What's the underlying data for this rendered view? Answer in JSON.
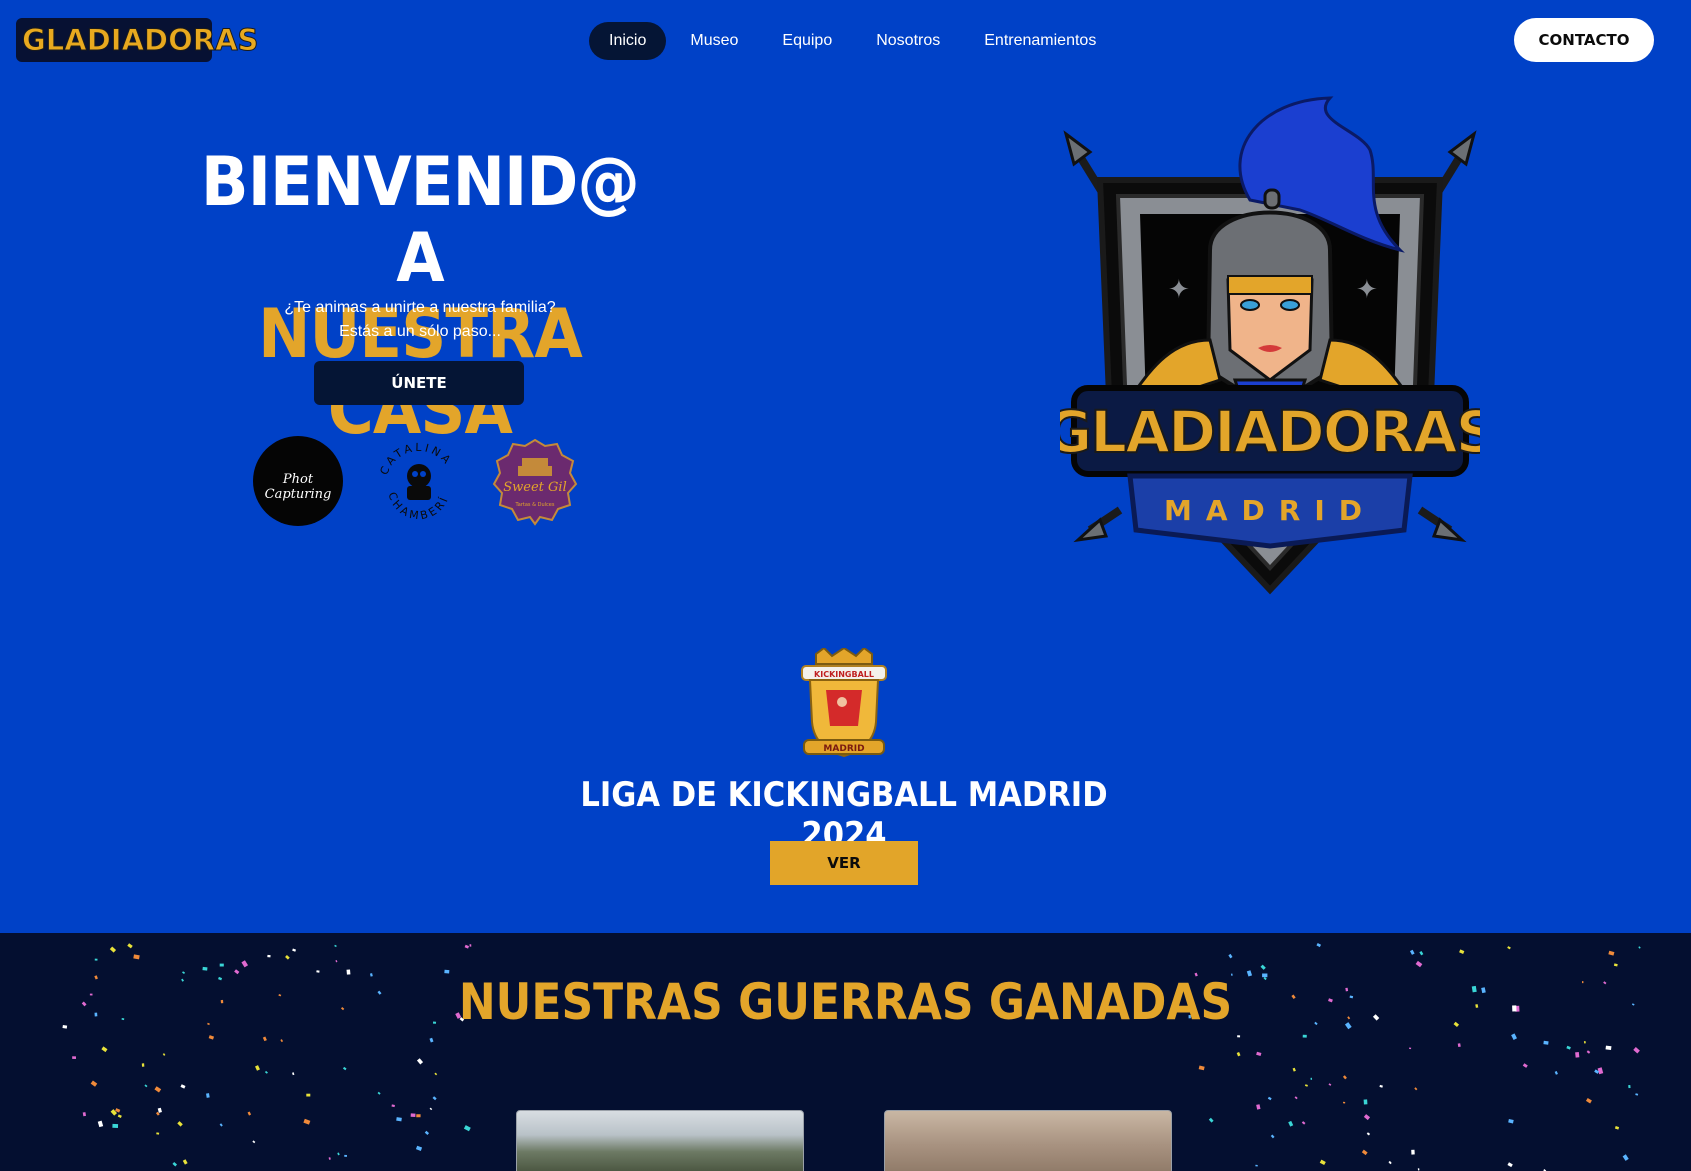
{
  "nav": {
    "logo_text": "GLADIADORAS",
    "menu": [
      {
        "label": "Inicio",
        "active": true
      },
      {
        "label": "Museo",
        "active": false
      },
      {
        "label": "Equipo",
        "active": false
      },
      {
        "label": "Nosotros",
        "active": false
      },
      {
        "label": "Entrenamientos",
        "active": false
      }
    ],
    "contact_label": "CONTACTO"
  },
  "hero": {
    "title_line1": "BIENVENID@ A",
    "title_line2": "NUESTRA CASA",
    "subtitle_line1": "¿Te animas a unirte a nuestra familia?",
    "subtitle_line2": "Estás a un sólo paso...",
    "join_label": "ÚNETE",
    "sponsors": [
      {
        "name": "photo-capturing-logo",
        "text": "Phot Capturing"
      },
      {
        "name": "catalina-chamberi-logo",
        "text": "CATALINA CHAMBERÍ"
      },
      {
        "name": "sweet-gil-logo",
        "text": "Sweet Gil"
      }
    ],
    "crest_text": "GLADIADORAS",
    "crest_subtext": "MADRID"
  },
  "liga": {
    "crest_top": "KICKINGBALL",
    "crest_bottom": "MADRID",
    "title": "LIGA DE KICKINGBALL MADRID 2024",
    "ver_label": "VER"
  },
  "wars": {
    "title": "NUESTRAS GUERRAS GANADAS"
  },
  "colors": {
    "primary_blue": "#0041c7",
    "navy": "#051535",
    "gold": "#e3a52a",
    "dark_bg": "#040f30"
  }
}
